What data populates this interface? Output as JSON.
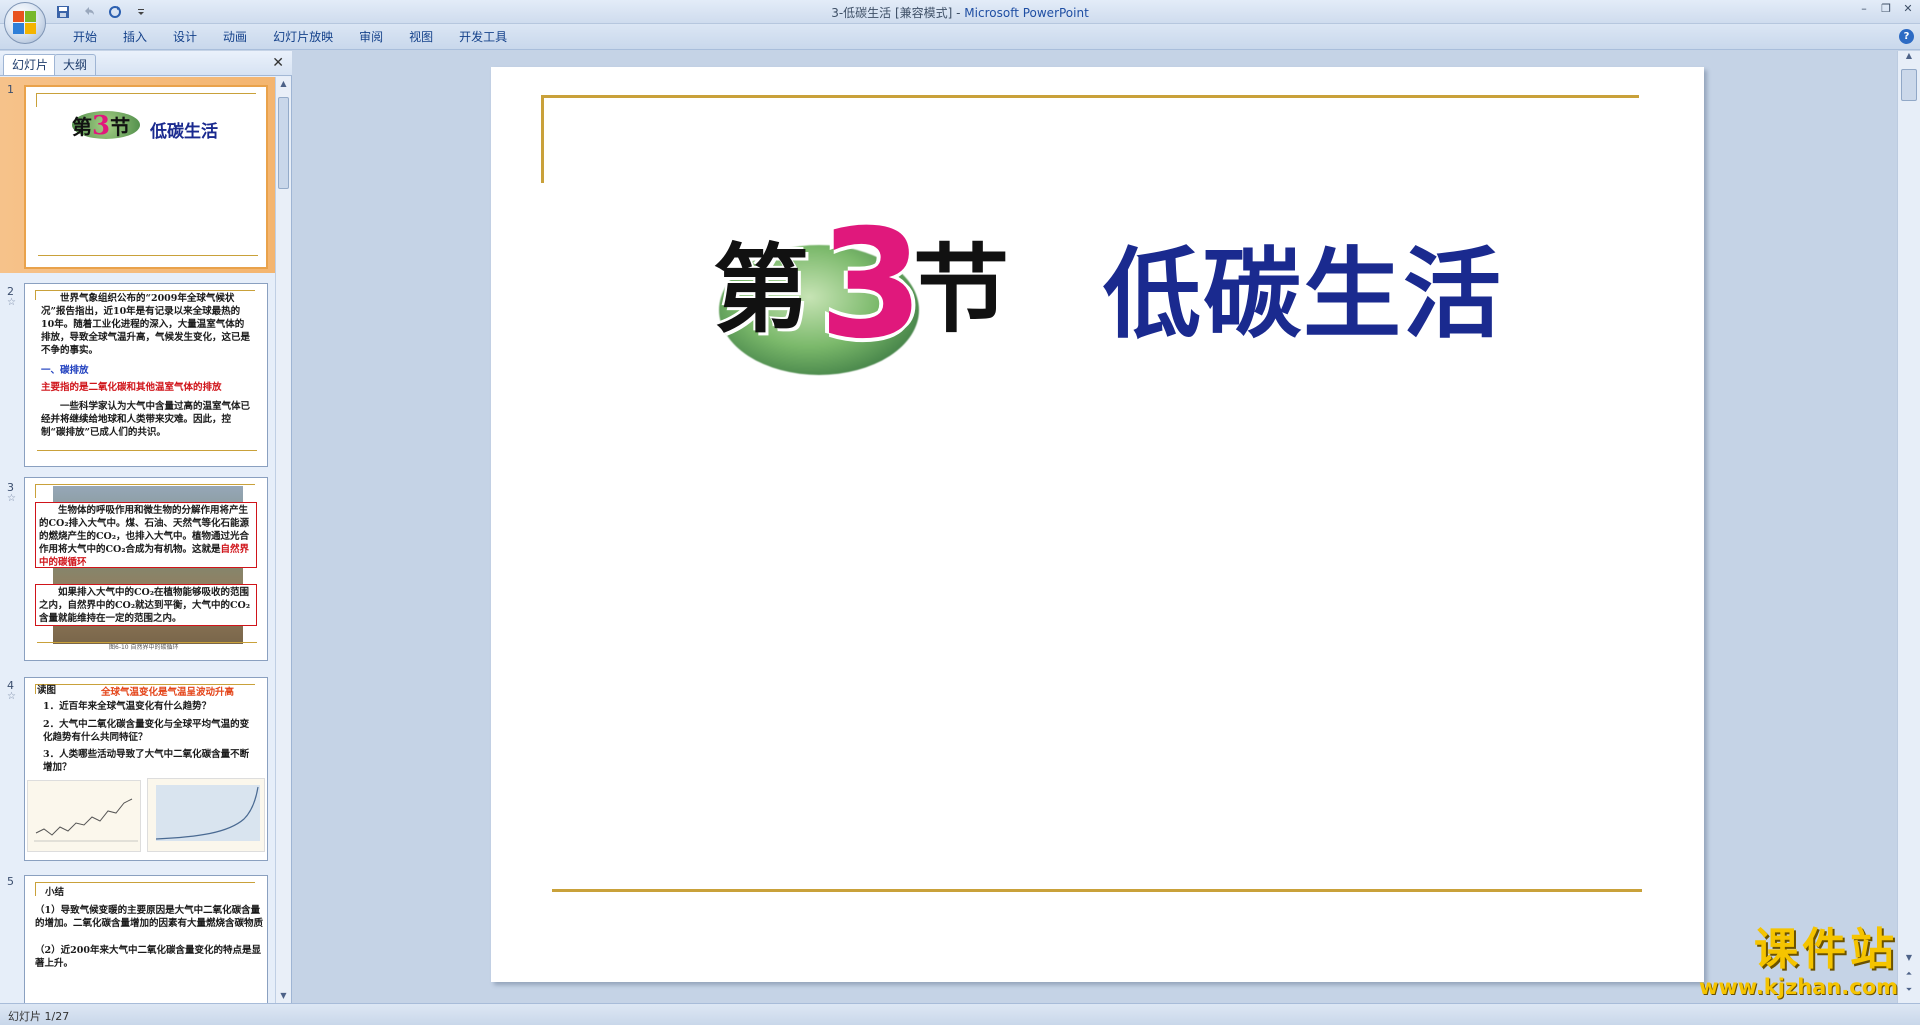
{
  "window": {
    "title_doc": "3-低碳生活 [兼容模式] - ",
    "title_app": "Microsoft PowerPoint"
  },
  "quick_access": [
    "save-icon",
    "undo-icon",
    "redo-icon",
    "customize-icon"
  ],
  "ribbon": {
    "tabs": [
      "开始",
      "插入",
      "设计",
      "动画",
      "幻灯片放映",
      "审阅",
      "视图",
      "开发工具"
    ]
  },
  "left_panel": {
    "tabs": [
      "幻灯片",
      "大纲"
    ],
    "slides": [
      {
        "num": "1",
        "title_mark": "第",
        "title_num": "3",
        "title_mark2": "节",
        "title_text": "低碳生活"
      },
      {
        "num": "2",
        "p1": "世界气象组织公布的“2009年全球气候状况”报告指出，近10年是有记录以来全球最热的10年。随着工业化进程的深入，大量温室气体的排放，导致全球气温升高，气候发生变化，这已是不争的事实。",
        "h1": "一、碳排放",
        "h2": "主要指的是二氧化碳和其他温室气体的排放",
        "p2": "一些科学家认为大气中含量过高的温室气体已经并将继续给地球和人类带来灾难。因此，控制“碳排放”已成人们的共识。"
      },
      {
        "num": "3",
        "p1": "生物体的呼吸作用和微生物的分解作用将产生的CO₂排入大气中。煤、石油、天然气等化石能源的燃烧产生的CO₂，也排入大气中。植物通过光合作用将大气中的CO₂合成为有机物。这就是",
        "p1_red": "自然界中的碳循环",
        "p2": "如果排入大气中的CO₂在植物能够吸收的范围之内，自然界中的CO₂就达到平衡，大气中的CO₂含量就能维持在一定的范围之内。",
        "caption": "图6-10  自然界中的碳循环"
      },
      {
        "num": "4",
        "label": "读图",
        "red": "全球气温变化是气温呈波动升高",
        "q1": "1．近百年来全球气温变化有什么趋势？",
        "q2": "2．大气中二氧化碳含量变化与全球平均气温的变化趋势有什么共同特征？",
        "q3": "3．人类哪些活动导致了大气中二氧化碳含量不断增加？"
      },
      {
        "num": "5",
        "label": "小结",
        "p1": "（1）导致气候变暖的主要原因是大气中二氧化碳含量的增加。二氧化碳含量增加的因素有大量燃烧含碳物质",
        "p2": "（2）近200年来大气中二氧化碳含量变化的特点是显著上升。"
      }
    ]
  },
  "slide": {
    "title_mark": "第",
    "title_num": "3",
    "title_mark2": "节",
    "title_text": "低碳生活"
  },
  "status": {
    "text": "幻灯片 1/27"
  },
  "watermark": {
    "cn": "课件站",
    "url": "www.kjzhan.com"
  },
  "colors": {
    "gold": "#c9a13a",
    "title_blue": "#1a2a8f",
    "accent_pink": "#e0187c"
  }
}
